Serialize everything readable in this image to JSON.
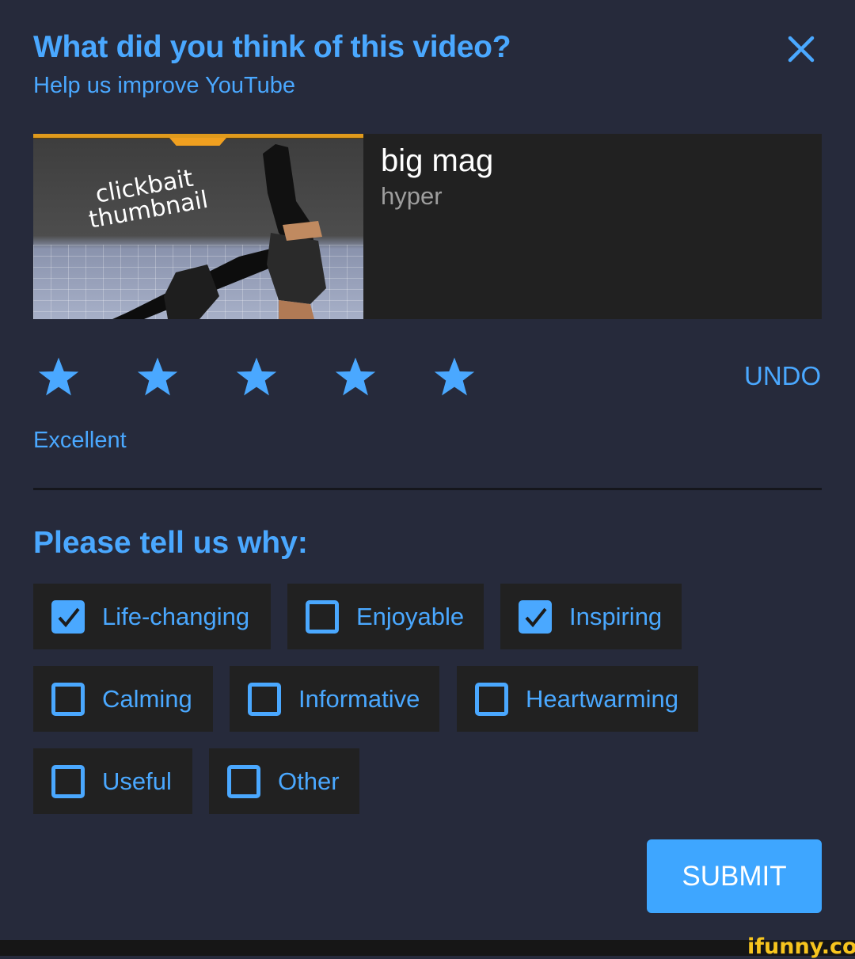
{
  "dialog": {
    "title": "What did you think of this video?",
    "subtitle": "Help us improve YouTube",
    "close_icon": "close-icon"
  },
  "video": {
    "title": "big mag",
    "channel": "hyper",
    "thumbnail_caption_line1": "clickbait",
    "thumbnail_caption_line2": "thumbnail"
  },
  "rating": {
    "value": 5,
    "max": 5,
    "label": "Excellent",
    "undo_label": "UNDO",
    "star_icon": "star-icon"
  },
  "reasons": {
    "heading": "Please tell us why:",
    "options": [
      {
        "label": "Life-changing",
        "checked": true
      },
      {
        "label": "Enjoyable",
        "checked": false
      },
      {
        "label": "Inspiring",
        "checked": true
      },
      {
        "label": "Calming",
        "checked": false
      },
      {
        "label": "Informative",
        "checked": false
      },
      {
        "label": "Heartwarming",
        "checked": false
      },
      {
        "label": "Useful",
        "checked": false
      },
      {
        "label": "Other",
        "checked": false
      }
    ]
  },
  "actions": {
    "submit_label": "SUBMIT"
  },
  "watermark": "ifunny.co",
  "colors": {
    "accent": "#4aa8ff",
    "background": "#262a3b",
    "card": "#212121",
    "submit": "#3ea6ff"
  }
}
